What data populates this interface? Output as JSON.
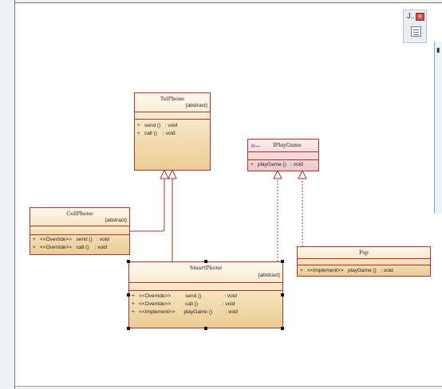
{
  "diagram": {
    "classes": {
      "telphone": {
        "name": "TelPhone",
        "stereotype": "{abstract}",
        "members": [
          {
            "vis": "+",
            "sig": "send ()   : void"
          },
          {
            "vis": "+",
            "sig": "call ()    : void"
          }
        ]
      },
      "iplaygame": {
        "name": "IPlayGame",
        "icon": "interface-icon",
        "members": [
          {
            "vis": "+",
            "sig": "playGame ()   : void"
          }
        ]
      },
      "cellphone": {
        "name": "CellPhone",
        "stereotype": "{abstract}",
        "members": [
          {
            "vis": "+",
            "sig": "<<Override>>   send ()   : void"
          },
          {
            "vis": "+",
            "sig": "<<Override>>   call ()    : void"
          }
        ]
      },
      "smartphone": {
        "name": "SmartPhone",
        "stereotype": "{abstract}",
        "members": [
          {
            "vis": "+",
            "sig": "<<Override>>          send ()                : void"
          },
          {
            "vis": "+",
            "sig": "<<Override>>          call ()                 : void"
          },
          {
            "vis": "+",
            "sig": "<<Implement>>      playGame ()         : void"
          }
        ]
      },
      "psp": {
        "name": "Psp",
        "members": [
          {
            "vis": "+",
            "sig": "<<Implement>>   playGame ()   : void"
          }
        ]
      }
    }
  },
  "toolbox": {
    "label": "J.."
  },
  "colors": {
    "border": "#a8332e",
    "class_fill": "#f4dfb6",
    "interface_fill": "#eec8c8"
  }
}
